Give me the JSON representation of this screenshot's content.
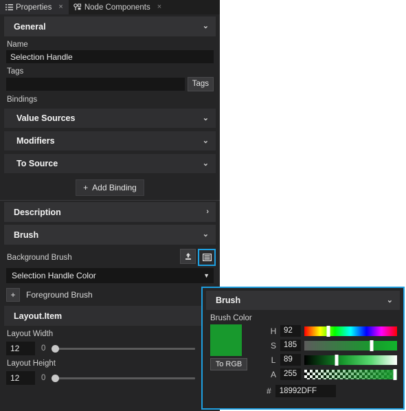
{
  "tabs": [
    {
      "label": "Properties",
      "icon": "list-icon",
      "close": "×",
      "active": true
    },
    {
      "label": "Node Components",
      "icon": "node-icon",
      "close": "×",
      "active": false
    }
  ],
  "sections": {
    "general": {
      "title": "General",
      "chevron": "⌄"
    },
    "description": {
      "title": "Description",
      "chevron": "›"
    },
    "brush": {
      "title": "Brush",
      "chevron": "⌄"
    },
    "layout_item": {
      "title": "Layout.Item",
      "chevron": ""
    }
  },
  "general": {
    "name_label": "Name",
    "name_value": "Selection Handle",
    "tags_label": "Tags",
    "tags_value": "",
    "tags_button": "Tags",
    "bindings_label": "Bindings",
    "bind_rows": [
      {
        "label": "Value Sources",
        "chevron": "⌄"
      },
      {
        "label": "Modifiers",
        "chevron": "⌄"
      },
      {
        "label": "To Source",
        "chevron": "⌄"
      }
    ],
    "add_binding": "Add Binding",
    "add_binding_plus": "+"
  },
  "brush": {
    "background_brush_label": "Background Brush",
    "upload_icon": "upload-icon",
    "panel_icon": "panel-icon",
    "combo_value": "Selection Handle Color",
    "combo_caret": "▼",
    "foreground_brush_label": "Foreground Brush",
    "foreground_plus": "+"
  },
  "layout": {
    "width_label": "Layout Width",
    "width_value": "12",
    "width_min": "0",
    "width_max": "200",
    "height_label": "Layout Height",
    "height_value": "12",
    "height_min": "0",
    "height_max": "200"
  },
  "popup": {
    "title": "Brush",
    "chevron": "⌄",
    "subtitle": "Brush Color",
    "swatch_color": "#18992D",
    "to_rgb_label": "To RGB",
    "hash": "#",
    "hex_value": "18992DFF",
    "channels": [
      {
        "letter": "H",
        "value": "92",
        "pos_pct": 25.6
      },
      {
        "letter": "S",
        "value": "185",
        "pos_pct": 72.5
      },
      {
        "letter": "L",
        "value": "89",
        "pos_pct": 34.5
      },
      {
        "letter": "A",
        "value": "255",
        "pos_pct": 98.0
      }
    ]
  },
  "colors": {
    "accent": "#1E9FE0",
    "panel_bg": "#252526",
    "header_bg": "#333335",
    "input_bg": "#161616",
    "brush_green": "#18992D"
  }
}
